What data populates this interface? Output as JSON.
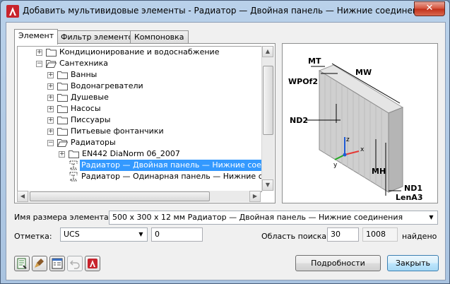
{
  "window": {
    "title": "Добавить мультивидовые элементы - Радиатор — Двойная панель — Нижние соединения",
    "close_label": "✕"
  },
  "tabs": [
    {
      "label": "Элемент",
      "active": true
    },
    {
      "label": "Фильтр элементов",
      "active": false
    },
    {
      "label": "Компоновка",
      "active": false
    }
  ],
  "tree": {
    "items": [
      {
        "label": "Кондиционирование и водоснабжение",
        "expander": "+"
      },
      {
        "label": "Сантехника",
        "expander": "−"
      },
      {
        "label": "Ванны",
        "expander": "+"
      },
      {
        "label": "Водонагреватели",
        "expander": "+"
      },
      {
        "label": "Душевые",
        "expander": "+"
      },
      {
        "label": "Насосы",
        "expander": "+"
      },
      {
        "label": "Писсуары",
        "expander": "+"
      },
      {
        "label": "Питьевые фонтанчики",
        "expander": "+"
      },
      {
        "label": "Радиаторы",
        "expander": "−"
      },
      {
        "label": "EN442 DiaNorm 06_2007",
        "expander": "+"
      },
      {
        "label": "Радиатор — Двойная панель — Нижние соед",
        "selected": true
      },
      {
        "label": "Радиатор — Одинарная панель — Нижние со"
      }
    ]
  },
  "preview": {
    "labels": {
      "mt": "MT",
      "mw": "MW",
      "wpof2": "WPOf2",
      "nd2": "ND2",
      "mh": "MH",
      "nd1": "ND1",
      "lena3": "LenA3"
    },
    "colors": {
      "x_axis": "#e53935",
      "y_axis": "#22aa22",
      "z_axis": "#1e5bd6"
    }
  },
  "form": {
    "part_size_label": "Имя размера элемента:",
    "part_size_value": "500 x 300 x 12 мм Радиатор — Двойная панель — Нижние соединения",
    "elevation_label": "Отметка:",
    "elevation_ucs": "UCS",
    "elevation_value": "0",
    "search_label": "Область поиска:",
    "search_value": "30",
    "found_count": "1008",
    "found_label": "найдено"
  },
  "buttons": {
    "details": "Подробности",
    "close": "Закрыть"
  },
  "icons": [
    "catalog-icon",
    "paint-icon",
    "properties-icon",
    "undo-icon",
    "app-icon"
  ]
}
